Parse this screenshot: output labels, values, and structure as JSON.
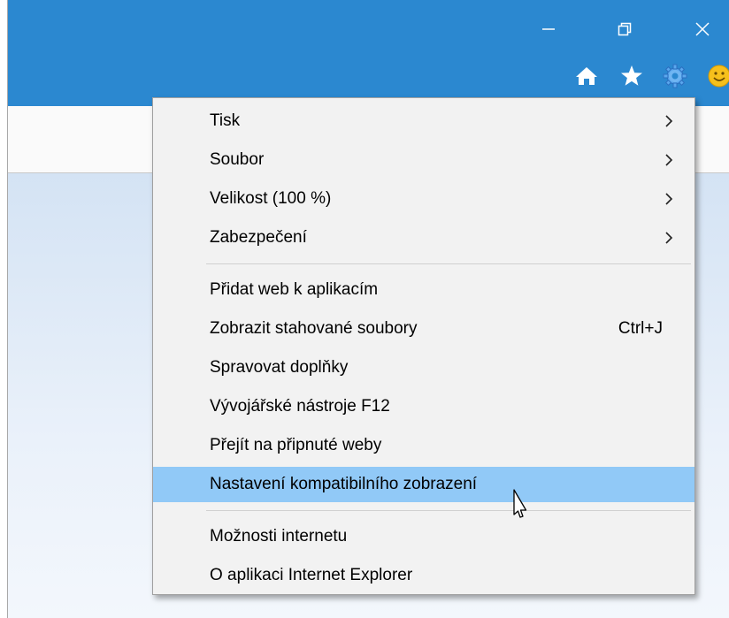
{
  "window": {
    "minimize_label": "—",
    "restore_label": "▭",
    "close_label": "✕"
  },
  "toolbar": {
    "icons": [
      "home-icon",
      "favorites-star-icon",
      "tools-gear-icon",
      "feedback-smiley-icon"
    ]
  },
  "colors": {
    "titlebar": "#2b88d0",
    "menu_background": "#f2f2f2",
    "highlight": "#91c9f7",
    "gear": "#3b8ee5",
    "smiley": "#f6c01c"
  },
  "menu": {
    "group1": [
      {
        "label": "Tisk",
        "has_submenu": true
      },
      {
        "label": "Soubor",
        "has_submenu": true
      },
      {
        "label": "Velikost (100 %)",
        "has_submenu": true
      },
      {
        "label": "Zabezpečení",
        "has_submenu": true
      }
    ],
    "group2": [
      {
        "label": "Přidat web k aplikacím"
      },
      {
        "label": "Zobrazit stahované soubory",
        "shortcut": "Ctrl+J"
      },
      {
        "label": "Spravovat doplňky"
      },
      {
        "label": "Vývojářské nástroje F12"
      },
      {
        "label": "Přejít na připnuté weby"
      },
      {
        "label": "Nastavení kompatibilního zobrazení",
        "highlighted": true
      }
    ],
    "group3": [
      {
        "label": "Možnosti internetu"
      },
      {
        "label": "O aplikaci Internet Explorer"
      }
    ]
  }
}
